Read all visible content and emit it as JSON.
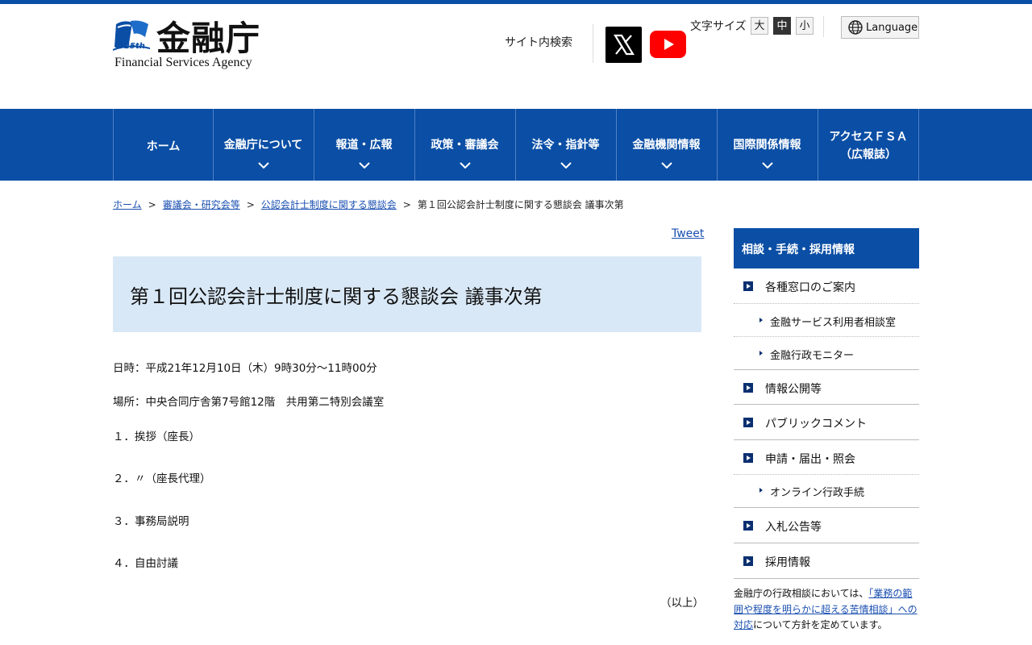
{
  "header": {
    "logo_title": "金融庁",
    "logo_sub": "Financial Services Agency",
    "logo_badge": "25th",
    "site_search": "サイト内検索",
    "font_size_label": "文字サイズ",
    "font_sizes": [
      "大",
      "中",
      "小"
    ],
    "font_size_active": "中",
    "language": "Language",
    "brand_color": "#0a4ea5"
  },
  "nav": [
    {
      "label": "ホーム"
    },
    {
      "label": "金融庁について"
    },
    {
      "label": "報道・広報"
    },
    {
      "label": "政策・審議会"
    },
    {
      "label": "法令・指針等"
    },
    {
      "label": "金融機関情報"
    },
    {
      "label": "国際関係情報"
    },
    {
      "label_line1": "アクセスＦＳＡ",
      "label_line2": "（広報誌）"
    }
  ],
  "breadcrumb": {
    "home": "ホーム",
    "level1": "審議会・研究会等",
    "level2": "公認会計士制度に関する懇談会",
    "current": "第１回公認会計士制度に関する懇談会 議事次第",
    "sep": ">"
  },
  "tweet": "Tweet",
  "main": {
    "title": "第１回公認会計士制度に関する懇談会 議事次第",
    "date": "日時：平成21年12月10日（木）9時30分～11時00分",
    "place": "場所：中央合同庁舎第7号館12階　共用第二特別会議室",
    "agenda": [
      "１．挨拶（座長）",
      "２．〃（座長代理）",
      "３．事務局説明",
      "４．自由討議"
    ],
    "end": "（以上）"
  },
  "sidebar": {
    "heading": "相談・手続・採用情報",
    "item1": "各種窓口のご案内",
    "sub1a": "金融サービス利用者相談室",
    "sub1b": "金融行政モニター",
    "item2": "情報公開等",
    "item3": "パブリックコメント",
    "item4": "申請・届出・照会",
    "sub4a": "オンライン行政手続",
    "item5": "入札公告等",
    "item6": "採用情報",
    "note_pre": "金融庁の行政相談においては、",
    "note_link1": "「業務の範囲や程度を明らかに超える苦情相談」への対応",
    "note_post": "について方針を定めています。"
  }
}
